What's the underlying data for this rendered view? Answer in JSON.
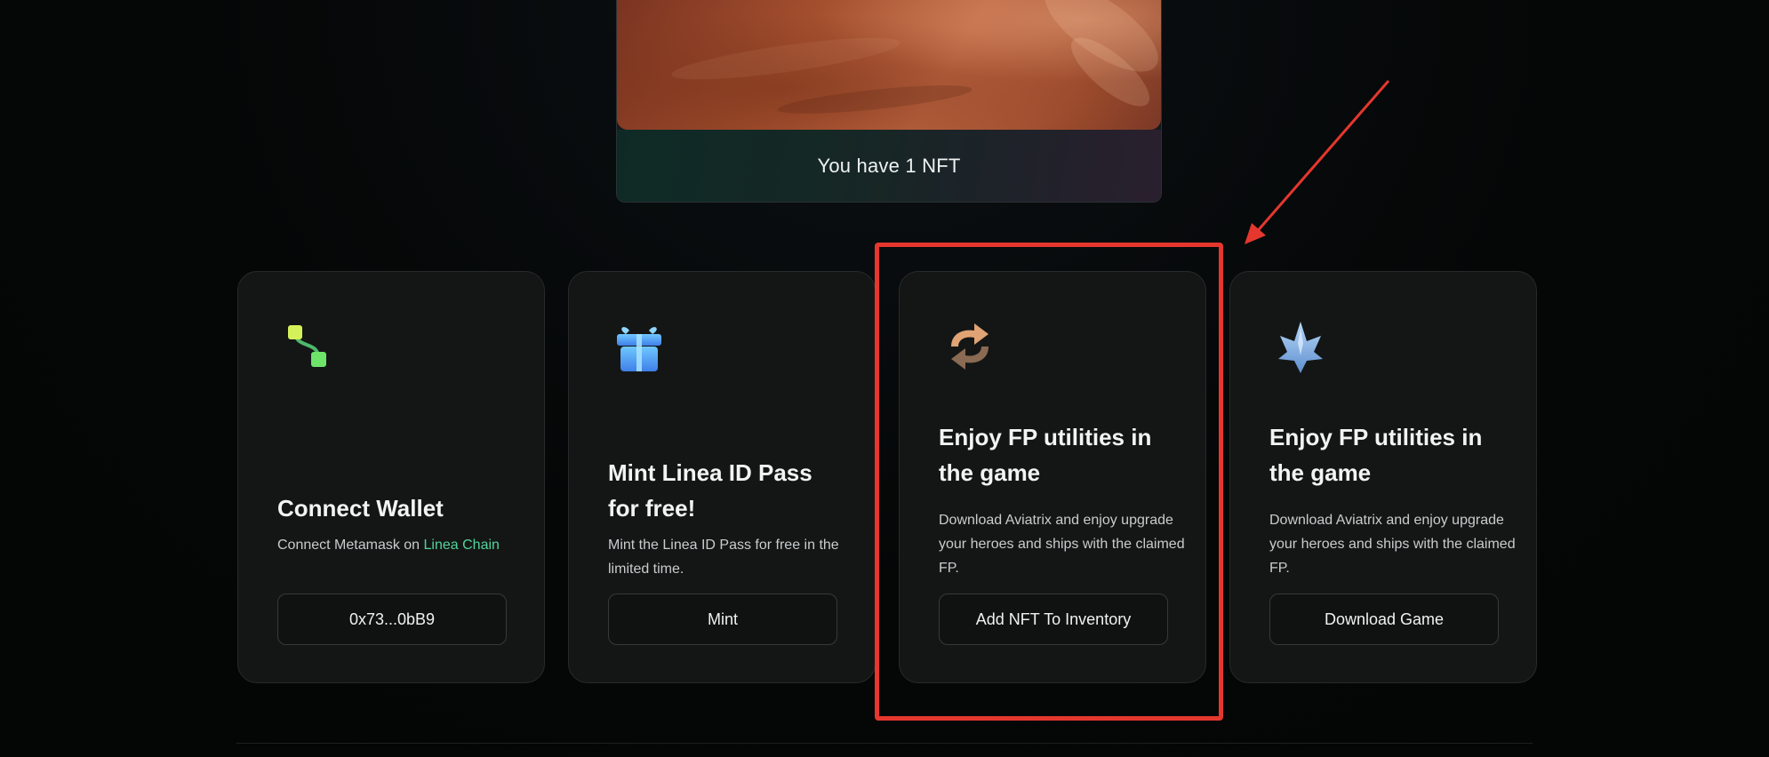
{
  "nft": {
    "count_text": "You have 1 NFT"
  },
  "steps": [
    {
      "icon": "wallet-connection-icon",
      "title": "Connect Wallet",
      "desc_prefix": "Connect Metamask on ",
      "desc_link": "Linea Chain",
      "button_label": "0x73...0bB9"
    },
    {
      "icon": "gift-icon",
      "title": "Mint Linea ID Pass for free!",
      "desc": "Mint the Linea ID Pass for free in the limited time.",
      "button_label": "Mint"
    },
    {
      "icon": "exchange-arrows-icon",
      "title": "Enjoy FP utilities in the game",
      "desc": "Download Aviatrix and enjoy upgrade your heroes and ships with the claimed FP.",
      "button_label": "Add NFT To Inventory"
    },
    {
      "icon": "spaceship-icon",
      "title": "Enjoy FP utilities in the game",
      "desc": "Download Aviatrix and enjoy upgrade your heroes and ships with the claimed FP.",
      "button_label": "Download Game"
    }
  ],
  "colors": {
    "background": "#050606",
    "card": "#141616",
    "link": "#54d39a",
    "annotation": "#e5372e"
  }
}
